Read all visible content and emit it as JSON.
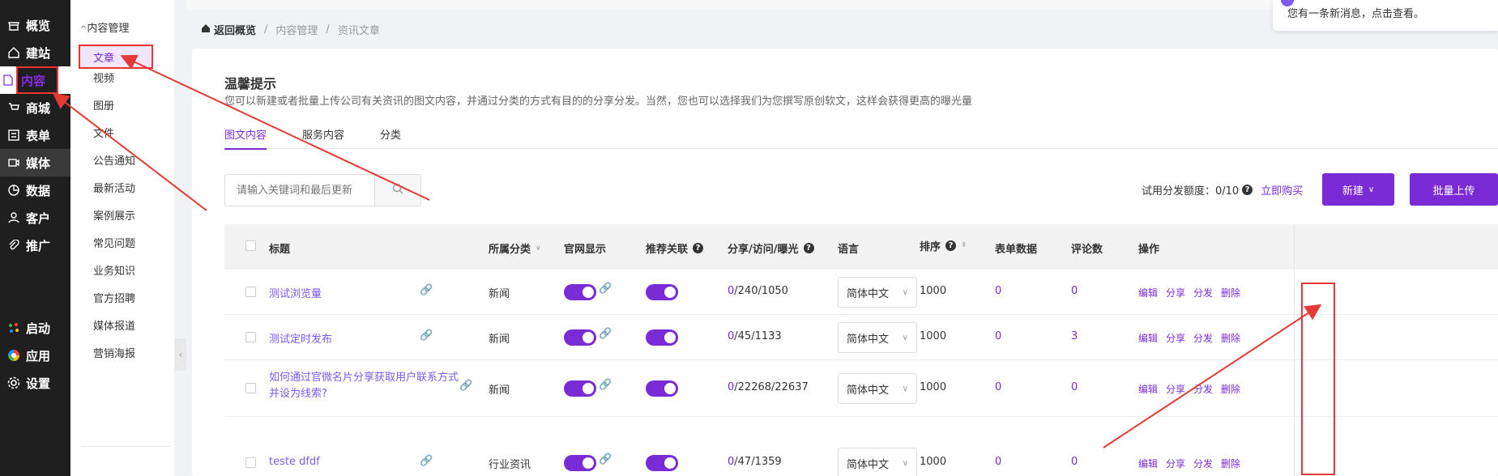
{
  "sidebar": {
    "items": [
      {
        "label": "概览",
        "icon": "storefront-icon"
      },
      {
        "label": "建站",
        "icon": "home-icon"
      },
      {
        "label": "内容",
        "icon": "document-icon"
      },
      {
        "label": "商城",
        "icon": "cart-icon"
      },
      {
        "label": "表单",
        "icon": "form-icon"
      },
      {
        "label": "媒体",
        "icon": "video-icon"
      },
      {
        "label": "数据",
        "icon": "chart-pie-icon"
      },
      {
        "label": "客户",
        "icon": "user-icon"
      },
      {
        "label": "推广",
        "icon": "paperclip-icon"
      }
    ],
    "bottom": [
      {
        "label": "启动",
        "icon": "dots-icon"
      },
      {
        "label": "应用",
        "icon": "apps-icon"
      },
      {
        "label": "设置",
        "icon": "gear-icon"
      }
    ]
  },
  "subnav": {
    "header": "内容管理",
    "items": [
      "文章",
      "视频",
      "图册",
      "文件",
      "公告通知",
      "最新活动",
      "案例展示",
      "常见问题",
      "业务知识",
      "官方招聘",
      "媒体报道",
      "营销海报"
    ]
  },
  "breadcrumb": {
    "home": "返回概览",
    "level1": "内容管理",
    "level2": "资讯文章"
  },
  "notice": {
    "text": "您有一条新消息，点击查看。"
  },
  "tip": {
    "title": "温馨提示",
    "text": "您可以新建或者批量上传公司有关资讯的图文内容，并通过分类的方式有目的的分享分发。当然，您也可以选择我们为您撰写原创软文，这样会获得更高的曝光量"
  },
  "tabs": [
    "图文内容",
    "服务内容",
    "分类"
  ],
  "search": {
    "placeholder": "请输入关键词和最后更新"
  },
  "quota": {
    "label": "试用分发额度：0/10",
    "buy": "立即购买"
  },
  "buttons": {
    "new": "新建",
    "batch": "批量上传"
  },
  "table": {
    "headers": {
      "title": "标题",
      "category": "所属分类",
      "site": "官网显示",
      "related": "推荐关联",
      "stats": "分享/访问/曝光",
      "lang": "语言",
      "sort": "排序",
      "form": "表单数据",
      "comments": "评论数",
      "ops": "操作"
    },
    "ops": {
      "edit": "编辑",
      "share": "分享",
      "distribute": "分发",
      "delete": "删除"
    },
    "rows": [
      {
        "title": "测试浏览量",
        "category": "新闻",
        "shares": "0",
        "stats_rest": "/240/1050",
        "lang": "简体中文",
        "sort": "1000",
        "form": "0",
        "comments": "0"
      },
      {
        "title": "测试定时发布",
        "category": "新闻",
        "shares": "0",
        "stats_rest": "/45/1133",
        "lang": "简体中文",
        "sort": "1000",
        "form": "0",
        "comments": "3"
      },
      {
        "title": "如何通过官微名片分享获取用户联系方式并设为线索?",
        "category": "新闻",
        "shares": "0",
        "stats_rest": "/22268/22637",
        "lang": "简体中文",
        "sort": "1000",
        "form": "0",
        "comments": "0"
      },
      {
        "title": "teste dfdf",
        "category": "行业资讯",
        "shares": "0",
        "stats_rest": "/47/1359",
        "lang": "简体中文",
        "sort": "1000",
        "form": "0",
        "comments": "0"
      }
    ]
  },
  "colors": {
    "accent": "#7a2bd6",
    "annotation": "#e53935"
  }
}
